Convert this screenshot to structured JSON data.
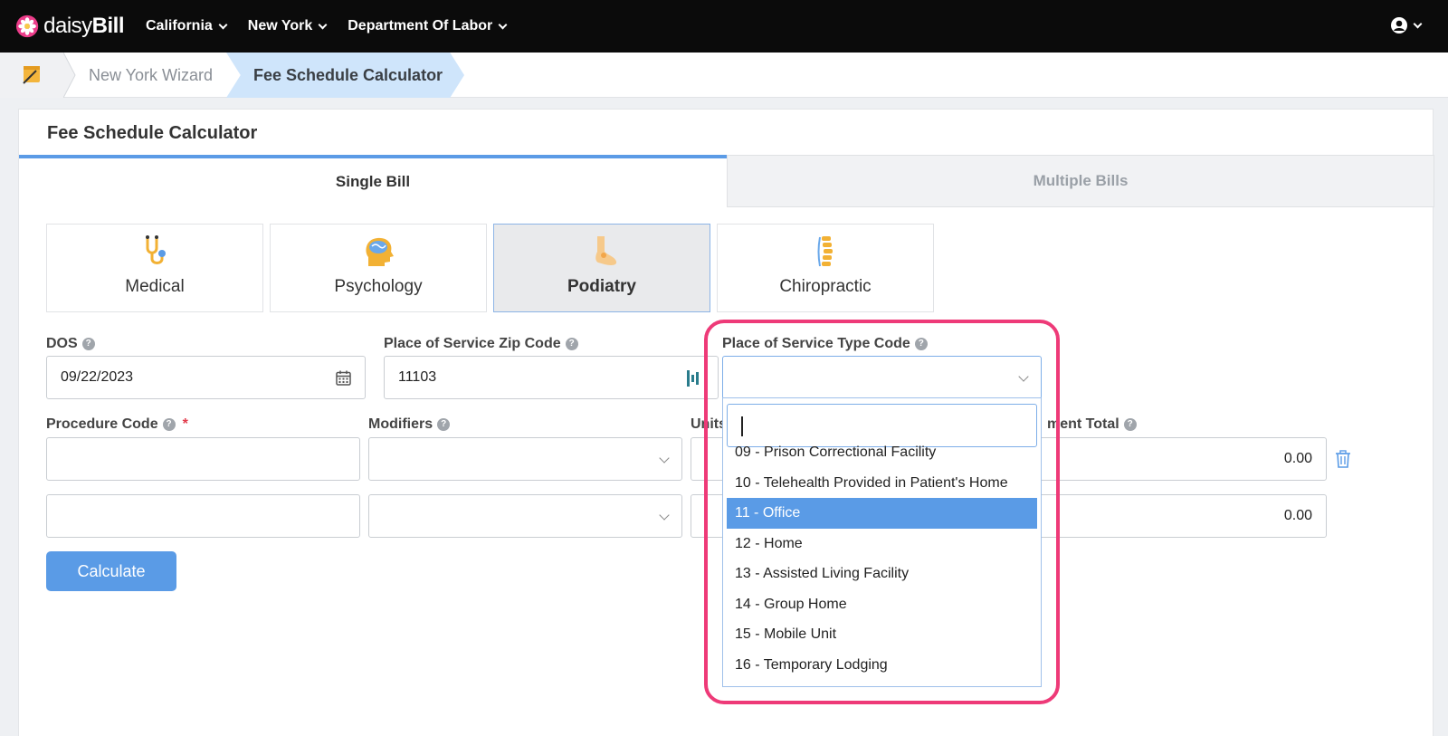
{
  "brand": {
    "name_light": "daisy",
    "name_bold": "Bill"
  },
  "nav": {
    "items": [
      "California",
      "New York",
      "Department Of Labor"
    ]
  },
  "breadcrumb": {
    "items": [
      "New York Wizard",
      "Fee Schedule Calculator"
    ]
  },
  "page": {
    "title": "Fee Schedule Calculator"
  },
  "tabs": {
    "single": "Single Bill",
    "multiple": "Multiple Bills",
    "active": "Single Bill"
  },
  "specialties": [
    {
      "label": "Medical",
      "icon": "stethoscope-icon",
      "active": false
    },
    {
      "label": "Psychology",
      "icon": "brain-icon",
      "active": false
    },
    {
      "label": "Podiatry",
      "icon": "foot-icon",
      "active": true
    },
    {
      "label": "Chiropractic",
      "icon": "spine-icon",
      "active": false
    }
  ],
  "form": {
    "dos_label": "DOS",
    "dos_value": "09/22/2023",
    "zip_label": "Place of Service Zip Code",
    "zip_value": "11103",
    "pos_type_label": "Place of Service Type Code",
    "procedure_label": "Procedure Code",
    "required_mark": "*",
    "modifiers_label": "Modifiers",
    "units_label": "Units",
    "payment_total_label": "ment Total",
    "row1_total": "0.00",
    "row2_total": "0.00",
    "calculate_label": "Calculate"
  },
  "dropdown": {
    "search_value": "",
    "options": [
      "09 - Prison Correctional Facility",
      "10 - Telehealth Provided in Patient's Home",
      "11 - Office",
      "12 - Home",
      "13 - Assisted Living Facility",
      "14 - Group Home",
      "15 - Mobile Unit",
      "16 - Temporary Lodging"
    ],
    "selected": "11 - Office"
  },
  "colors": {
    "accent": "#5a9be6",
    "highlight": "#ee3a78",
    "nav_bg": "#0b0b0b",
    "crumb_active": "#cfe5fb"
  }
}
